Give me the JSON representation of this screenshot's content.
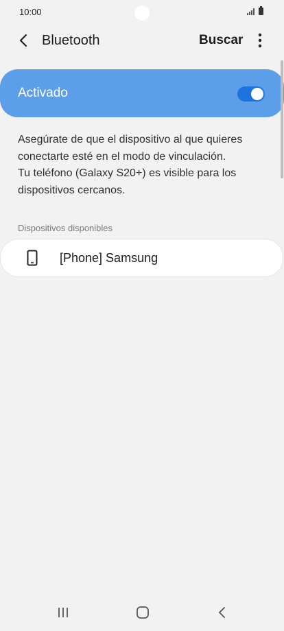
{
  "status_bar": {
    "time": "10:00",
    "icons": [
      "signal-icon",
      "battery-icon"
    ]
  },
  "header": {
    "title": "Bluetooth",
    "search_label": "Buscar",
    "icons": [
      "back-arrow-icon",
      "more-options-icon"
    ]
  },
  "bluetooth_toggle": {
    "label": "Activado",
    "state": "on"
  },
  "description": {
    "line_1": "Asegúrate de que el dispositivo al que quieres conectarte esté en el modo de vinculación.",
    "line_2": "Tu teléfono (Galaxy S20+) es visible para los dispositivos cercanos."
  },
  "available_devices": {
    "section_title": "Dispositivos disponibles",
    "items": [
      {
        "name": "[Phone] Samsung",
        "icon": "phone-icon"
      }
    ]
  },
  "navigation_bar": {
    "icons": [
      "recent-apps-icon",
      "home-icon",
      "back-icon"
    ]
  },
  "colors": {
    "background": "#f2f2f2",
    "toggle_card": "#5c9ee8",
    "toggle_switch": "#1c74e0",
    "card": "#ffffff"
  }
}
